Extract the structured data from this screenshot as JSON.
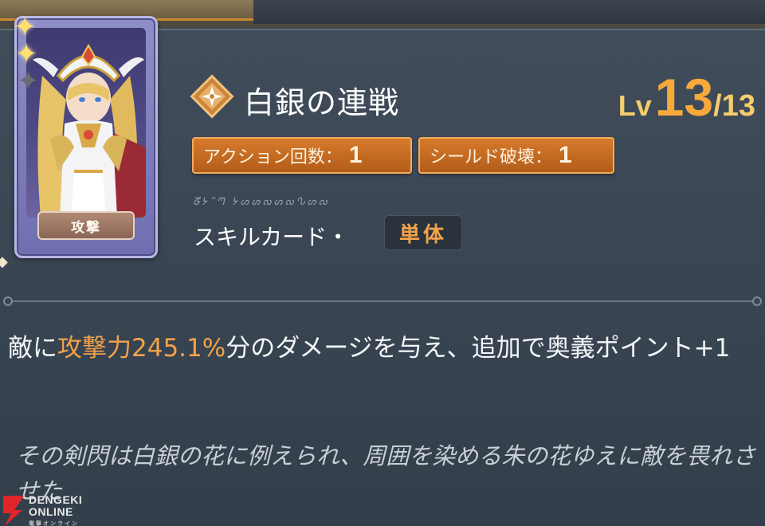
{
  "top": {
    "left_text": "",
    "right_text": ""
  },
  "card": {
    "type_label": "攻撃",
    "stars": 3
  },
  "skill": {
    "icon": "shuriken-diamond-icon",
    "name": "白銀の連戦",
    "level_prefix": "Lv",
    "level_current": "13",
    "level_max": "/13",
    "tags": [
      {
        "label": "アクション回数：",
        "value": "1"
      },
      {
        "label": "シールド破壊：",
        "value": "1"
      }
    ],
    "script_line": "ᘔᔭᐢᘉ ᔭᔕᔕᔓᔕᔓᔐᔕᔓ",
    "card_type": "スキルカード・",
    "target": "単体"
  },
  "description": {
    "prefix": "敵に",
    "highlight": "攻撃力245.1%",
    "suffix": "分のダメージを与え、追加で奥義ポイント+1"
  },
  "flavor_text": "その剣閃は白銀の花に例えられ、周囲を染める朱の花ゆえに敵を畏れさせた",
  "watermark": {
    "line1": "DENGEKI",
    "line2": "ONLINE",
    "sub": "電撃オンライン"
  },
  "colors": {
    "accent_orange": "#f2a24a",
    "level_gold": "#f4cd6e",
    "tag_orange": "#d67a2c",
    "card_purple": "#8e8ec8"
  }
}
